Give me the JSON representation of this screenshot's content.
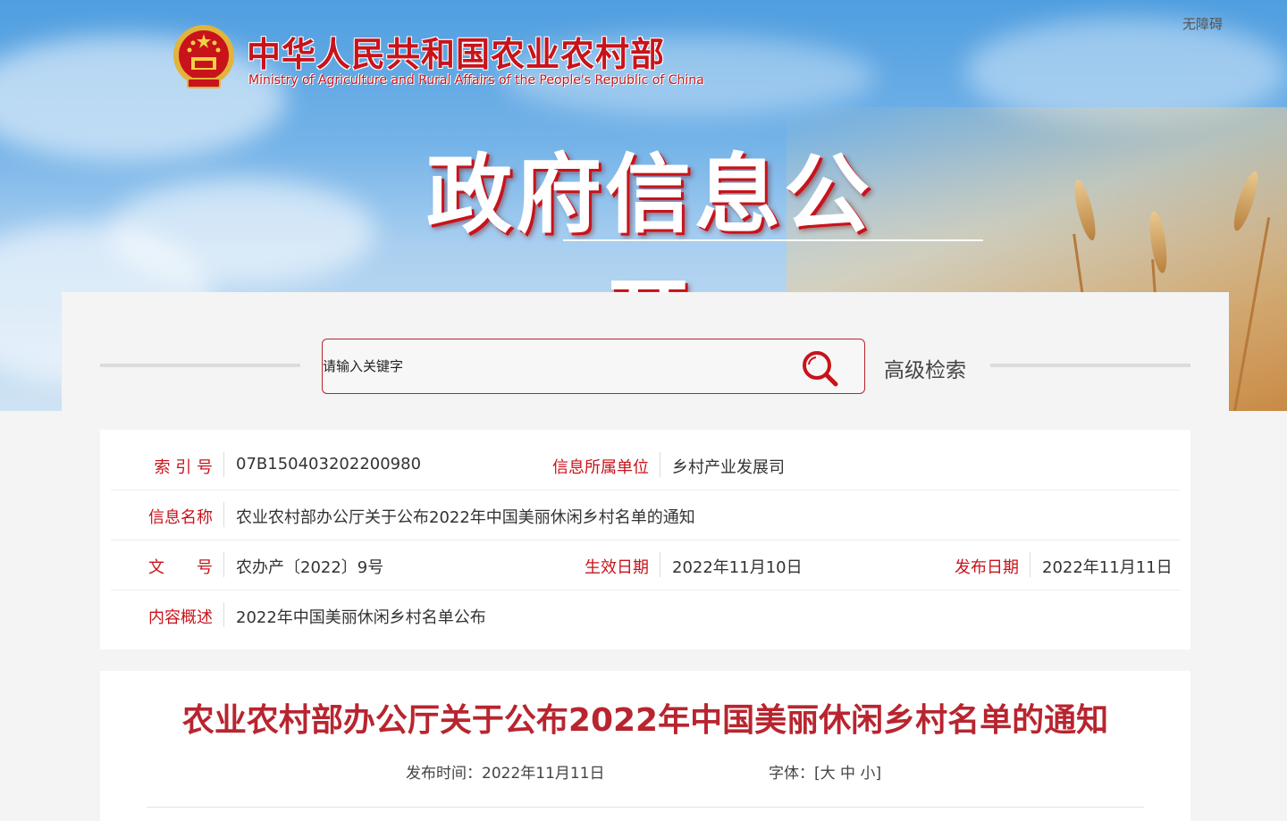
{
  "header": {
    "accessibility_label": "无障碍",
    "logo_cn": "中华人民共和国农业农村部",
    "logo_en": "Ministry of Agriculture and Rural Affairs of the People's Republic of China",
    "section_title": "政府信息公开"
  },
  "search": {
    "placeholder": "请输入关键字",
    "icon": "search-icon",
    "advanced_label": "高级检索"
  },
  "info": {
    "index_label": "索 引 号",
    "index_value": "07B150403202200980",
    "unit_label": "信息所属单位",
    "unit_value": "乡村产业发展司",
    "name_label": "信息名称",
    "name_value": "农业农村部办公厅关于公布2022年中国美丽休闲乡村名单的通知",
    "doc_label": "文　　号",
    "doc_value": "农办产〔2022〕9号",
    "effective_label": "生效日期",
    "effective_value": "2022年11月10日",
    "publish_label": "发布日期",
    "publish_value": "2022年11月11日",
    "summary_label": "内容概述",
    "summary_value": "2022年中国美丽休闲乡村名单公布"
  },
  "article": {
    "title": "农业农村部办公厅关于公布2022年中国美丽休闲乡村名单的通知",
    "publish_time_label": "发布时间：",
    "publish_time_value": "2022年11月11日",
    "font_label": "字体：",
    "font_open": "[",
    "font_large": "大",
    "font_medium": "中",
    "font_small": "小",
    "font_close": "]"
  },
  "colors": {
    "accent": "#c8131b",
    "title_red": "#b8252f"
  }
}
